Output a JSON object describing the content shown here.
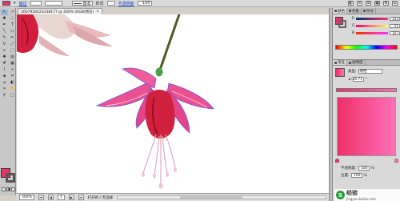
{
  "control_bar": {
    "fill_color": "#e8336b",
    "stroke_label": "描边",
    "brush_value": "基本",
    "style_label": "样式",
    "opacity_label": "不透明度",
    "opacity_value": "100",
    "arrow": "▾"
  },
  "document": {
    "tab_title": "2007918123138177 @ 300% (RGB/预览)",
    "close_glyph": "×"
  },
  "tools": [
    {
      "name": "selection-tool-icon",
      "glyph": "↖"
    },
    {
      "name": "direct-selection-tool-icon",
      "glyph": "↗"
    },
    {
      "name": "magic-wand-tool-icon",
      "glyph": "✱"
    },
    {
      "name": "lasso-tool-icon",
      "glyph": "◌"
    },
    {
      "name": "pen-tool-icon",
      "glyph": "✒"
    },
    {
      "name": "type-tool-icon",
      "glyph": "T"
    },
    {
      "name": "line-tool-icon",
      "glyph": "╲"
    },
    {
      "name": "rectangle-tool-icon",
      "glyph": "▭"
    },
    {
      "name": "paintbrush-tool-icon",
      "glyph": "✎"
    },
    {
      "name": "pencil-tool-icon",
      "glyph": "✏"
    },
    {
      "name": "rotate-tool-icon",
      "glyph": "↻"
    },
    {
      "name": "scale-tool-icon",
      "glyph": "⤢"
    },
    {
      "name": "warp-tool-icon",
      "glyph": "≈"
    },
    {
      "name": "free-transform-tool-icon",
      "glyph": "⬚"
    },
    {
      "name": "symbol-sprayer-tool-icon",
      "glyph": "✺"
    },
    {
      "name": "graph-tool-icon",
      "glyph": "▥"
    },
    {
      "name": "mesh-tool-icon",
      "glyph": "#"
    },
    {
      "name": "gradient-tool-icon",
      "glyph": "▦"
    },
    {
      "name": "eyedropper-tool-icon",
      "glyph": "⌇"
    },
    {
      "name": "blend-tool-icon",
      "glyph": "∞"
    },
    {
      "name": "live-paint-tool-icon",
      "glyph": "◈"
    },
    {
      "name": "crop-area-tool-icon",
      "glyph": "⌗"
    },
    {
      "name": "slice-tool-icon",
      "glyph": "⊿"
    },
    {
      "name": "eraser-tool-icon",
      "glyph": "◧"
    },
    {
      "name": "scissors-tool-icon",
      "glyph": "✂"
    },
    {
      "name": "hand-tool-icon",
      "glyph": "✋"
    },
    {
      "name": "zoom-tool-icon",
      "glyph": "⚲"
    },
    {
      "name": "print-tiling-tool-icon",
      "glyph": "▢"
    }
  ],
  "status_bar": {
    "zoom": "300%",
    "page": "1",
    "info": "打开的 / 无选择"
  },
  "color_panel": {
    "tabs": [
      "颜色",
      "色板",
      "符号"
    ],
    "channels": [
      {
        "label": "R",
        "value": "255"
      },
      {
        "label": "G",
        "value": "51"
      },
      {
        "label": "B",
        "value": "107"
      }
    ],
    "preview_color": "#e8336b"
  },
  "gradient_panel": {
    "tabs": [
      "渐变",
      "透明度"
    ],
    "type_label": "类型:",
    "type_value": "线性",
    "angle_value": "-18.71",
    "angle_unit": "°",
    "start_color": "#ef2f6a",
    "end_color": "#ff70b8",
    "opacity_label": "不透明度:",
    "location_label": "位置:",
    "opacity_value": "100",
    "location_value": "100",
    "percent": "%"
  },
  "watermark": {
    "logo_glyph": "S",
    "text": "经验",
    "url": "jingyan.baidu.com"
  }
}
